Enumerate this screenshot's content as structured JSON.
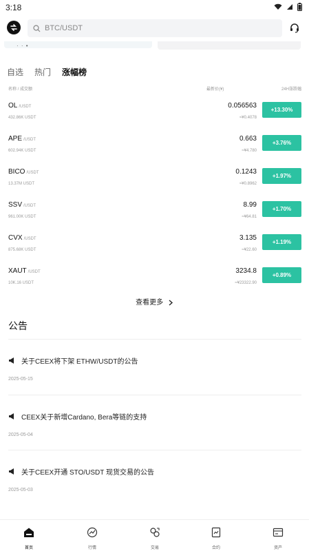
{
  "status": {
    "time": "3:18"
  },
  "search": {
    "placeholder": "BTC/USDT"
  },
  "tabs": [
    {
      "label": "自选"
    },
    {
      "label": "热门"
    },
    {
      "label": "涨幅榜"
    }
  ],
  "columns": {
    "name_volume": "名称 / 成交额",
    "latest_price": "最新价(¥)",
    "change_24h": "24H涨跌幅"
  },
  "rows": [
    {
      "symbol": "OL",
      "quote": "/USDT",
      "volume": "432.86K USDT",
      "price": "0.056563",
      "fiat": "≈¥0.4078",
      "change": "+13.30%"
    },
    {
      "symbol": "APE",
      "quote": "/USDT",
      "volume": "602.94K USDT",
      "price": "0.663",
      "fiat": "≈¥4.780",
      "change": "+3.76%"
    },
    {
      "symbol": "BICO",
      "quote": "/USDT",
      "volume": "13.37M USDT",
      "price": "0.1243",
      "fiat": "≈¥0.8962",
      "change": "+1.97%"
    },
    {
      "symbol": "SSV",
      "quote": "/USDT",
      "volume": "961.00K USDT",
      "price": "8.99",
      "fiat": "≈¥64.81",
      "change": "+1.70%"
    },
    {
      "symbol": "CVX",
      "quote": "/USDT",
      "volume": "875.68K USDT",
      "price": "3.135",
      "fiat": "≈¥22.60",
      "change": "+1.19%"
    },
    {
      "symbol": "XAUT",
      "quote": "/USDT",
      "volume": "10K.16 USDT",
      "price": "3234.8",
      "fiat": "≈¥23322.90",
      "change": "+0.89%"
    }
  ],
  "view_more": "查看更多",
  "announcements_title": "公告",
  "announcements": [
    {
      "title": "关于CEEX将下架 ETHW/USDT的公告",
      "date": "2025-05-15"
    },
    {
      "title": "CEEX关于新增Cardano, Bera等链的支持",
      "date": "2025-05-04"
    },
    {
      "title": "关于CEEX开通 STO/USDT 现货交易的公告",
      "date": "2025-05-03"
    }
  ],
  "bottom_nav": [
    {
      "label": "首页",
      "icon": "home-icon"
    },
    {
      "label": "行情",
      "icon": "market-icon"
    },
    {
      "label": "交易",
      "icon": "trade-icon"
    },
    {
      "label": "合约",
      "icon": "contract-icon"
    },
    {
      "label": "资产",
      "icon": "assets-icon"
    }
  ],
  "colors": {
    "accent": "#2cc2a2"
  }
}
